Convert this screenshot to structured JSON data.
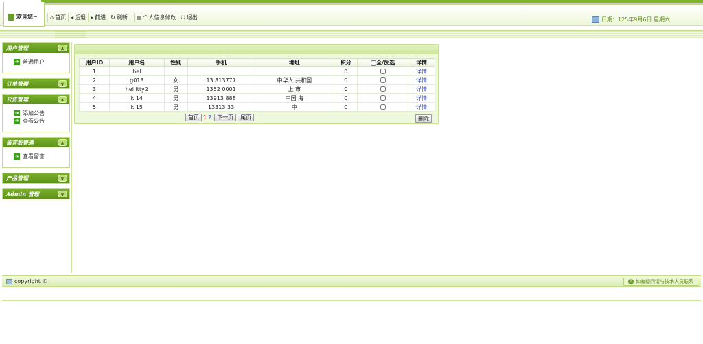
{
  "header": {
    "welcome": "欢迎您~",
    "toolbar": [
      {
        "icon": "home-icon",
        "glyph": "⌂",
        "label": "首页"
      },
      {
        "icon": "back-icon",
        "glyph": "◂",
        "label": "后退"
      },
      {
        "icon": "forward-icon",
        "glyph": "▸",
        "label": "前进"
      },
      {
        "icon": "refresh-icon",
        "glyph": "↻",
        "label": "刷新"
      },
      {
        "icon": "profile-icon",
        "glyph": "▤",
        "label": "个人信息修改"
      },
      {
        "icon": "power-icon",
        "glyph": "⏻",
        "label": "退出"
      }
    ],
    "date_label": "日期：125年9月6日 星期六"
  },
  "sidebar": [
    {
      "title": "用户管理",
      "toggle": "∧",
      "items": [
        "普通用户"
      ]
    },
    {
      "title": "订单管理",
      "toggle": "∨",
      "items": []
    },
    {
      "title": "公告管理",
      "toggle": "∧",
      "items": [
        "添加公告",
        "查看公告"
      ]
    },
    {
      "title": "留言板管理",
      "toggle": "∧",
      "items": [
        "查看留言"
      ]
    },
    {
      "title": "产品管理",
      "toggle": "∨",
      "items": []
    },
    {
      "title": "Admin 管理",
      "toggle": "∨",
      "items": []
    }
  ],
  "table": {
    "headers": [
      "用户ID",
      "用户名",
      "性别",
      "手机",
      "地址",
      "积分",
      "全/反选",
      "详情"
    ],
    "rows": [
      {
        "id": "1",
        "username": "hel",
        "gender": "",
        "phone": "",
        "address": "",
        "points": "0",
        "detail": "详情"
      },
      {
        "id": "2",
        "username": "g013",
        "gender": "女",
        "phone": "13 813777",
        "address": "中华人 共和国",
        "points": "0",
        "detail": "详情"
      },
      {
        "id": "3",
        "username": "hel itty2",
        "gender": "男",
        "phone": "1352 0001",
        "address": "上 市",
        "points": "0",
        "detail": "详情"
      },
      {
        "id": "4",
        "username": "k 14",
        "gender": "男",
        "phone": "13913 888",
        "address": "中国 海",
        "points": "0",
        "detail": "详情"
      },
      {
        "id": "5",
        "username": "k 15",
        "gender": "男",
        "phone": "13313 33",
        "address": "中",
        "points": "0",
        "detail": "详情"
      }
    ]
  },
  "pager": {
    "first": "首页",
    "page1": "1",
    "page2": "2",
    "next": "下一页",
    "last": "尾页"
  },
  "delete_label": "删除",
  "footer": {
    "copyright": "copyright ©",
    "help": "如有疑问请与技术人员联系"
  },
  "colors": {
    "brand_green": "#6a9b2d",
    "header_green": "#5d9219",
    "link_blue": "#2a3fb0"
  }
}
